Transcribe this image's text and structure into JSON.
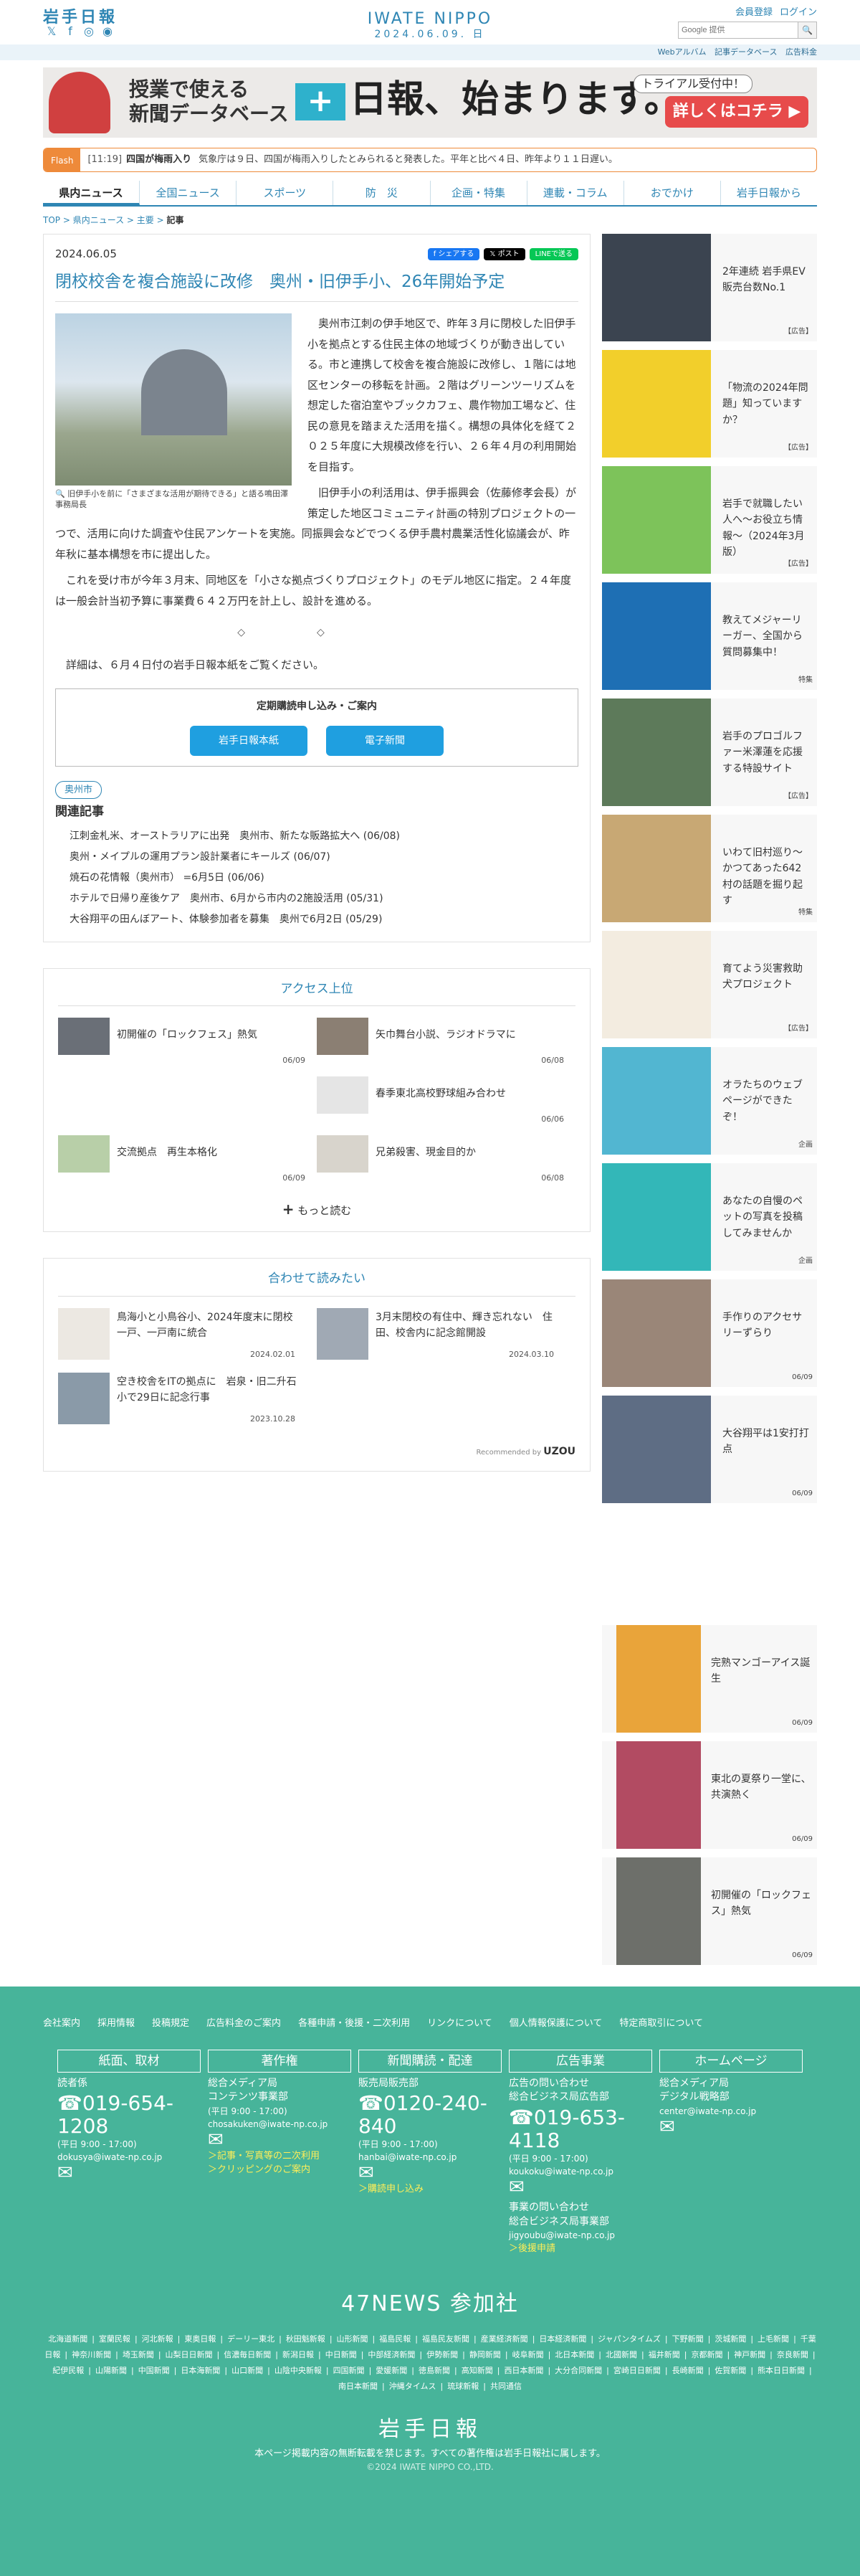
{
  "header": {
    "logo_left": "岩手日報",
    "logo_center": "IWATE NIPPO",
    "logo_date": "2024.06.09. 日",
    "member_link": "会員登録",
    "login_link": "ログイン",
    "search_placeholder": "Google 提供",
    "search_button": "🔍",
    "social_x": "𝕏",
    "social_fb": "f",
    "social_ig": "◎",
    "social_line": "◉"
  },
  "subbar": {
    "items": [
      "Webアルバム",
      "記事データベース",
      "広告料金"
    ]
  },
  "banner": {
    "line1": "授業で使える",
    "line2": "新聞データベース",
    "plus": "+",
    "big": "日報、始まります。",
    "trial": "トライアル受付中！",
    "cta": "詳しくはコチラ ▶"
  },
  "flash": {
    "tag": "Flash",
    "time": "[11:19]",
    "headline": "四国が梅雨入り",
    "text": "気象庁は９日、四国が梅雨入りしたとみられると発表した。平年と比べ４日、昨年より１１日遅い。"
  },
  "nav": {
    "items": [
      "県内ニュース",
      "全国ニュース",
      "スポーツ",
      "防　災",
      "企画・特集",
      "連載・コラム",
      "おでかけ",
      "岩手日報から"
    ]
  },
  "breadcrumb": {
    "top": "TOP",
    "cat": "県内ニュース",
    "sub": "主要",
    "current": "記事"
  },
  "article": {
    "date": "2024.06.05",
    "share_fb": "f シェアする",
    "share_x": "𝕏 ポスト",
    "share_line": "LINEで送る",
    "title": "閉校校舎を複合施設に改修　奥州・旧伊手小、26年開始予定",
    "photo_caption": "旧伊手小を前に「さまざまな活用が期待できる」と語る鳴田澤事務局長",
    "p1": "奥州市江刺の伊手地区で、昨年３月に閉校した旧伊手小を拠点とする住民主体の地域づくりが動き出している。市と連携して校舎を複合施設に改修し、１階には地区センターの移転を計画。２階はグリーンツーリズムを想定した宿泊室やブックカフェ、農作物加工場など、住民の意見を踏まえた活用を描く。構想の具体化を経て２０２５年度に大規模改修を行い、２６年４月の利用開始を目指す。",
    "p2": "旧伊手小の利活用は、伊手振興会（佐藤修孝会長）が策定した地区コミュニティ計画の特別プロジェクトの一つで、活用に向けた調査や住民アンケートを実施。同振興会などでつくる伊手農村農業活性化協議会が、昨年秋に基本構想を市に提出した。",
    "p3": "これを受け市が今年３月末、同地区を「小さな拠点づくりプロジェクト」のモデル地区に指定。２４年度は一般会計当初予算に事業費６４２万円を計上し、設計を進める。",
    "sep": "◇◇",
    "p4": "詳細は、６月４日付の岩手日報本紙をご覧ください。",
    "sub_title": "定期購読申し込み・ご案内",
    "sub_btn1": "岩手日報本紙",
    "sub_btn2": "電子新聞",
    "tag": "奥州市",
    "related_heading": "関連記事",
    "related": [
      "江刺金札米、オーストラリアに出発　奥州市、新たな販路拡大へ (06/08)",
      "奥州・メイプルの運用プラン設計業者にキールズ (06/07)",
      "焼石の花情報（奥州市） =6月5日 (06/06)",
      "ホテルで日帰り産後ケア　奥州市、6月から市内の2施設活用 (05/31)",
      "大谷翔平の田んぼアート、体験参加者を募集　奥州で6月2日 (05/29)"
    ]
  },
  "ranking": {
    "heading": "アクセス上位",
    "items": [
      {
        "title": "初開催の「ロックフェス」熱気",
        "date": "06/09"
      },
      {
        "title": "矢巾舞台小説、ラジオドラマに",
        "date": "06/08"
      },
      {
        "title": "",
        "date": ""
      },
      {
        "title": "春季東北高校野球組み合わせ",
        "date": "06/06"
      },
      {
        "title": "交流拠点　再生本格化",
        "date": "06/09"
      },
      {
        "title": "兄弟殺害、現金目的か",
        "date": "06/08"
      }
    ],
    "more": "もっと読む",
    "more_icon": "+"
  },
  "recommend": {
    "heading": "合わせて読みたい",
    "items": [
      {
        "title": "鳥海小と小鳥谷小、2024年度末に閉校　一戸、一戸南に統合",
        "date": "2024.02.01"
      },
      {
        "title": "3月末閉校の有住中、輝き忘れない　住田、校舎内に記念館開設",
        "date": "2024.03.10"
      },
      {
        "title": "空き校舎をITの拠点に　岩泉・旧二升石小で29日に記念行事",
        "date": "2023.10.28"
      }
    ],
    "powered": "Recommended by",
    "powered_brand": "UZOU"
  },
  "sidebar": {
    "ads": [
      {
        "text": "2年連続 岩手県EV販売台数No.1",
        "label": "【広告】",
        "color": "#3b4450"
      },
      {
        "text": "「物流の2024年問題」知っていますか？",
        "label": "【広告】",
        "color": "#f2cf2b"
      },
      {
        "text": "岩手で就職したい人へ〜お役立ち情報〜（2024年3月版）",
        "label": "【広告】",
        "color": "#7dc35a"
      },
      {
        "text": "教えてメジャーリーガー、全国から質問募集中！",
        "label": "特集",
        "color": "#1e6fb4"
      },
      {
        "text": "岩手のプロゴルファー米澤蓮を応援する特設サイト",
        "label": "【広告】",
        "color": "#5d7a5a"
      },
      {
        "text": "いわて旧村巡り〜かつてあった642村の話題を掘り起す",
        "label": "特集",
        "color": "#c8a874"
      },
      {
        "text": "育てよう災害救助犬プロジェクト",
        "label": "【広告】",
        "color": "#f3ece0"
      },
      {
        "text": "オラたちのウェブページができたぞ！",
        "label": "企画",
        "color": "#52b6d1"
      },
      {
        "text": "あなたの自慢のペットの写真を投稿してみませんか",
        "label": "企画",
        "color": "#33b7b8"
      },
      {
        "text": "手作りのアクセサリーずらり",
        "label": "06/09",
        "color": "#9a8678"
      },
      {
        "text": "大谷翔平は1安打打点",
        "label": "06/09",
        "color": "#5e6d84"
      }
    ],
    "ads2": [
      {
        "text": "完熟マンゴーアイス誕生",
        "label": "06/09",
        "color": "#e9a43a"
      },
      {
        "text": "東北の夏祭り一堂に、共演熱く",
        "label": "06/09",
        "color": "#b24b62"
      },
      {
        "text": "初開催の「ロックフェス」熱気",
        "label": "06/09",
        "color": "#6d6f6a"
      }
    ]
  },
  "footer": {
    "links": [
      "会社案内",
      "採用情報",
      "投稿規定",
      "広告料金のご案内",
      "各種申請・後援・二次利用",
      "リンクについて",
      "個人情報保護について",
      "特定商取引について"
    ],
    "col1": {
      "h": "紙面、取材",
      "l1": "読者係",
      "tel": "019-654-1208",
      "hours": "(平日 9:00 - 17:00)",
      "mail": "dokusya@iwate-np.co.jp",
      "icon": "✉"
    },
    "col2": {
      "h": "著作権",
      "l1": "総合メディア局",
      "l2": "コンテンツ事業部",
      "hours": "(平日 9:00 - 17:00)",
      "mail": "chosakuken@iwate-np.co.jp",
      "link1": "＞記事・写真等の二次利用",
      "link2": "＞クリッピングのご案内",
      "icon": "✉"
    },
    "col3": {
      "h": "新聞購読・配達",
      "l1": "販売局販売部",
      "tel": "0120-240-840",
      "hours": "(平日 9:00 - 17:00)",
      "mail": "hanbai@iwate-np.co.jp",
      "link1": "＞購読申し込み",
      "icon": "✉"
    },
    "col4": {
      "h": "広告事業",
      "l1": "広告の問い合わせ",
      "l2": "総合ビジネス局広告部",
      "tel": "019-653-4118",
      "hours": "(平日 9:00 - 17:00)",
      "mail": "koukoku@iwate-np.co.jp",
      "l3": "事業の問い合わせ",
      "l4": "総合ビジネス局事業部",
      "mail2": "jigyoubu@iwate-np.co.jp",
      "link1": "＞後援申請",
      "icon": "✉"
    },
    "col5": {
      "h": "ホームページ",
      "l1": "総合メディア局",
      "l2": "デジタル戦略部",
      "mail": "center@iwate-np.co.jp",
      "icon": "✉"
    },
    "n47": "47NEWS 参加社",
    "members": [
      "北海道新聞",
      "室蘭民報",
      "河北新報",
      "東奥日報",
      "デーリー東北",
      "秋田魁新報",
      "山形新聞",
      "福島民報",
      "福島民友新聞",
      "産業経済新聞",
      "日本経済新聞",
      "ジャパンタイムズ",
      "下野新聞",
      "茨城新聞",
      "上毛新聞",
      "千葉日報",
      "神奈川新聞",
      "埼玉新聞",
      "山梨日日新聞",
      "信濃毎日新聞",
      "新潟日報",
      "中日新聞",
      "中部経済新聞",
      "伊勢新聞",
      "静岡新聞",
      "岐阜新聞",
      "北日本新聞",
      "北國新聞",
      "福井新聞",
      "京都新聞",
      "神戸新聞",
      "奈良新聞",
      "紀伊民報",
      "山陽新聞",
      "中国新聞",
      "日本海新聞",
      "山口新聞",
      "山陰中央新報",
      "四国新聞",
      "愛媛新聞",
      "徳島新聞",
      "高知新聞",
      "西日本新聞",
      "大分合同新聞",
      "宮崎日日新聞",
      "長崎新聞",
      "佐賀新聞",
      "熊本日日新聞",
      "南日本新聞",
      "沖縄タイムス",
      "琉球新報",
      "共同通信"
    ],
    "logo": "岩手日報",
    "copy1": "本ページ掲載内容の無断転載を禁じます。すべての著作権は岩手日報社に属します。",
    "copy2": "©2024 IWATE NIPPO CO.,LTD."
  }
}
